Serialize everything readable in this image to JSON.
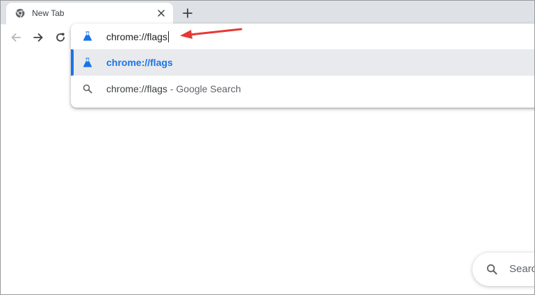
{
  "tab": {
    "title": "New Tab",
    "favicon": "chrome-logo-icon"
  },
  "toolbar": {
    "back": "back-arrow-icon",
    "forward": "forward-arrow-icon",
    "reload": "reload-icon"
  },
  "omnibox": {
    "input_value": "chrome://flags",
    "input_icon": "flask-icon",
    "suggestions": [
      {
        "icon": "flask-icon",
        "text": "chrome://flags",
        "selected": true
      },
      {
        "icon": "search-icon",
        "text": "chrome://flags",
        "suffix_separator": " - ",
        "suffix": "Google Search",
        "selected": false
      }
    ]
  },
  "ntp": {
    "search_label": "Search"
  },
  "colors": {
    "accent": "#1a73e8",
    "annotation": "#e53935",
    "tabstrip": "#dee1e6",
    "selected_row": "#e8eaed"
  }
}
